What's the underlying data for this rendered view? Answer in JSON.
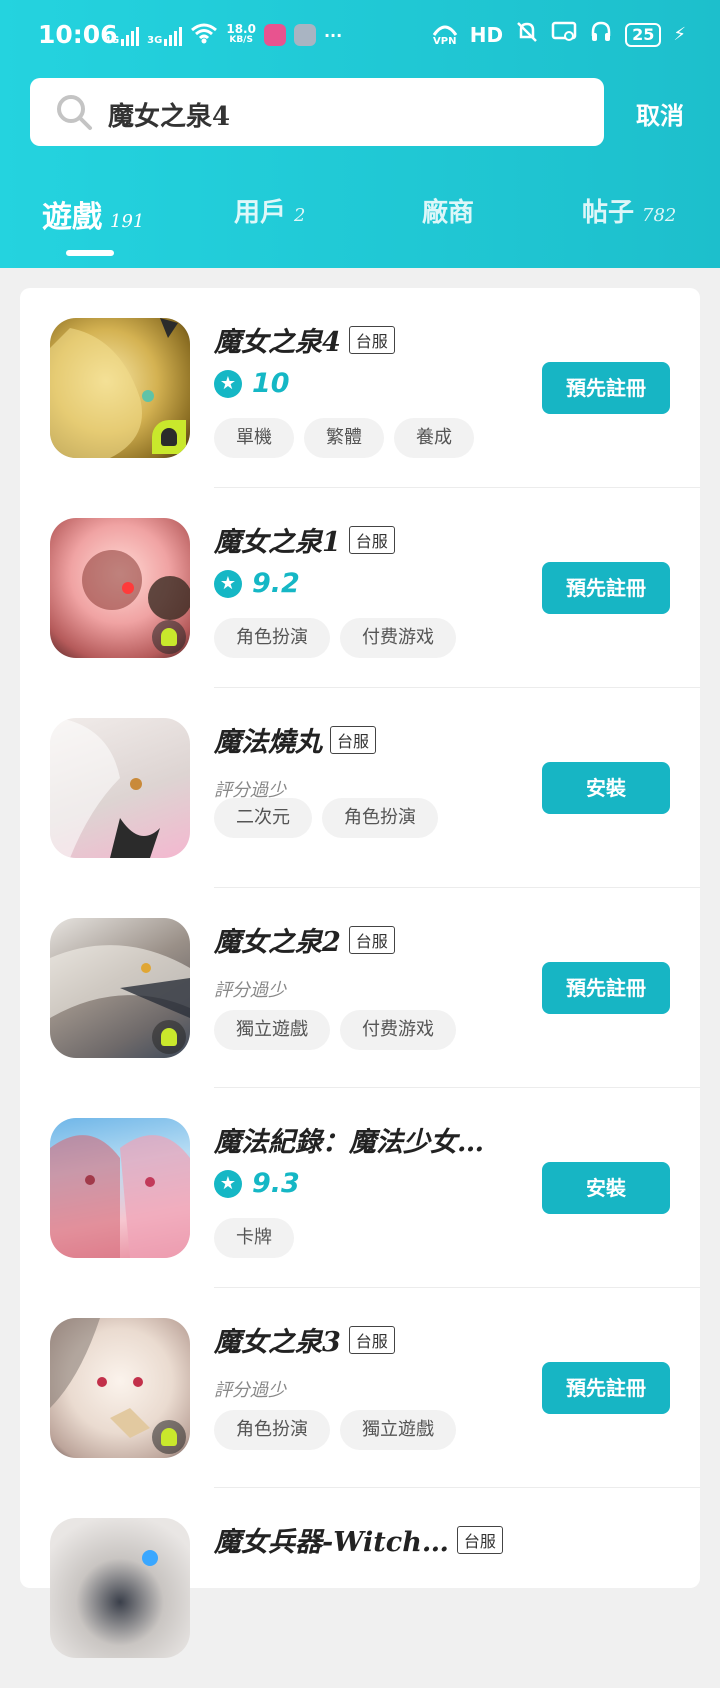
{
  "status": {
    "time": "10:06",
    "net1": "4G",
    "net2": "3G",
    "speed_value": "18.0",
    "speed_unit": "KB/S",
    "more": "···",
    "vpn": "VPN",
    "hd": "HD",
    "battery": "25"
  },
  "search": {
    "query": "魔女之泉4",
    "cancel_label": "取消"
  },
  "tabs": [
    {
      "label": "遊戲",
      "count": "191"
    },
    {
      "label": "用戶",
      "count": "2"
    },
    {
      "label": "廠商",
      "count": ""
    },
    {
      "label": "帖子",
      "count": "782"
    }
  ],
  "colors": {
    "accent": "#15b7c5",
    "header": "#20c9d6"
  },
  "results": [
    {
      "title": "魔女之泉4",
      "badge": "台服",
      "score": "10",
      "rating_note": "",
      "tags": [
        "單機",
        "繁體",
        "養成"
      ],
      "action": "預先註冊",
      "icon": "game-cover-witch-spring-4"
    },
    {
      "title": "魔女之泉1",
      "badge": "台服",
      "score": "9.2",
      "rating_note": "",
      "tags": [
        "角色扮演",
        "付费游戏"
      ],
      "action": "預先註冊",
      "icon": "game-cover-witch-spring-1"
    },
    {
      "title": "魔法燒丸",
      "badge": "台服",
      "score": "",
      "rating_note": "評分過少",
      "tags": [
        "二次元",
        "角色扮演"
      ],
      "action": "安裝",
      "icon": "game-cover-magic-shoumaru"
    },
    {
      "title": "魔女之泉2",
      "badge": "台服",
      "score": "",
      "rating_note": "評分過少",
      "tags": [
        "獨立遊戲",
        "付费游戏"
      ],
      "action": "預先註冊",
      "icon": "game-cover-witch-spring-2"
    },
    {
      "title": "魔法紀錄：魔法少女…",
      "badge": "",
      "score": "9.3",
      "rating_note": "",
      "tags": [
        "卡牌"
      ],
      "action": "安裝",
      "icon": "game-cover-magia-record"
    },
    {
      "title": "魔女之泉3",
      "badge": "台服",
      "score": "",
      "rating_note": "評分過少",
      "tags": [
        "角色扮演",
        "獨立遊戲"
      ],
      "action": "預先註冊",
      "icon": "game-cover-witch-spring-3"
    },
    {
      "title": "魔女兵器-Witch…",
      "badge": "台服",
      "score": "",
      "rating_note": "",
      "tags": [],
      "action": "",
      "icon": "game-cover-witch-weapon"
    }
  ]
}
